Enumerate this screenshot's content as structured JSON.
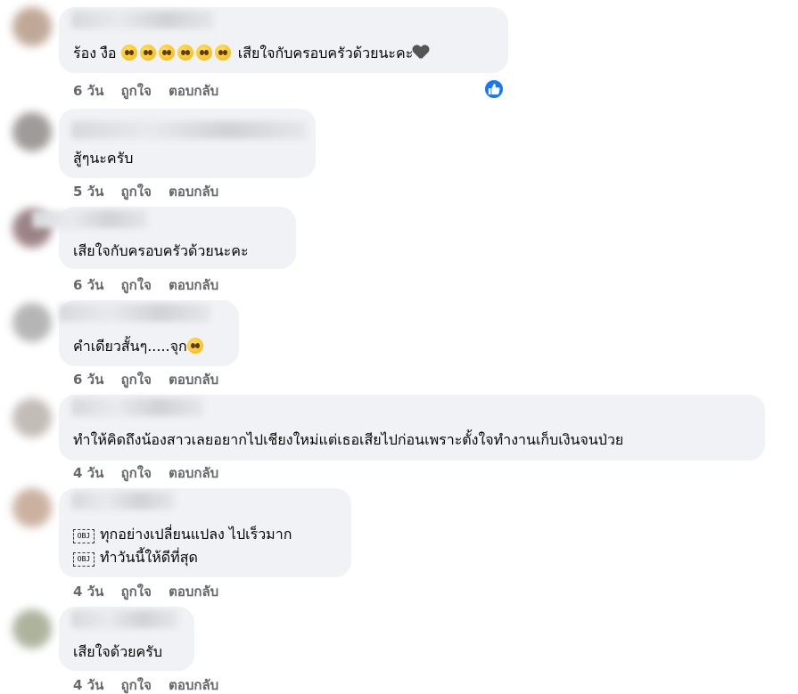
{
  "comments": [
    {
      "lines": [
        "ร้อง งือ",
        "เสียใจกับครอบครัวด้วยนะคะ"
      ],
      "meta": {
        "time": "6 วัน",
        "like": "ถูกใจ",
        "reply": "ตอบกลับ"
      },
      "reaction": "like-icon"
    },
    {
      "lines": [
        "สู้ๆนะครับ"
      ],
      "meta": {
        "time": "5 วัน",
        "like": "ถูกใจ",
        "reply": "ตอบกลับ"
      }
    },
    {
      "lines": [
        "เสียใจกับครอบครัวด้วยนะคะ"
      ],
      "meta": {
        "time": "6 วัน",
        "like": "ถูกใจ",
        "reply": "ตอบกลับ"
      }
    },
    {
      "lines": [
        "คำเดียวสั้นๆ.....จุก"
      ],
      "meta": {
        "time": "6 วัน",
        "like": "ถูกใจ",
        "reply": "ตอบกลับ"
      }
    },
    {
      "lines": [
        "ทำให้คิดถึงน้องสาวเลยอยากไปเชียงใหม่แต่เธอเสียไปก่อนเพราะตั้งใจทำงานเก็บเงินจนป่วย"
      ],
      "meta": {
        "time": "4 วัน",
        "like": "ถูกใจ",
        "reply": "ตอบกลับ"
      }
    },
    {
      "lines": [
        "ทุกอย่างเปลี่ยนแปลง ไปเร็วมาก",
        "ทำวันนี้ให้ดีที่สุด"
      ],
      "obj_glyph": "OBJ",
      "meta": {
        "time": "4 วัน",
        "like": "ถูกใจ",
        "reply": "ตอบกลับ"
      }
    },
    {
      "lines": [
        "เสียใจด้วยครับ"
      ],
      "meta": {
        "time": "4 วัน",
        "like": "ถูกใจ",
        "reply": "ตอบกลับ"
      }
    }
  ],
  "colors": {
    "bubble": "#f0f2f5",
    "meta_text": "#65676b",
    "like_blue": "#1877f2"
  }
}
